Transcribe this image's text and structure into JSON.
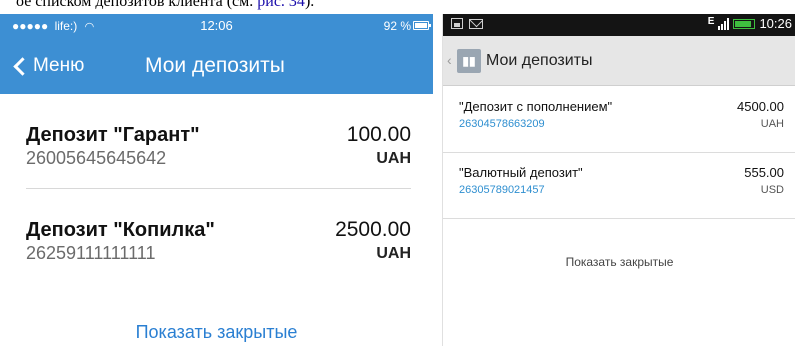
{
  "caption": {
    "text": "ое списком депозитов клиента (см.",
    "link": "рис. 34",
    "tail": ")."
  },
  "ios": {
    "status": {
      "dots": "●●●●●",
      "carrier": "life:)",
      "wifi": "wifi-icon",
      "time": "12:06",
      "battery": "92 %"
    },
    "nav": {
      "back_label": "Меню",
      "title": "Мои депозиты"
    },
    "deposits": [
      {
        "name": "Депозит \"Гарант\"",
        "account": "26005645645642",
        "amount": "100.00",
        "currency": "UAH"
      },
      {
        "name": "Депозит \"Копилка\"",
        "account": "26259111111111",
        "amount": "2500.00",
        "currency": "UAH"
      }
    ],
    "show_closed": "Показать закрытые"
  },
  "android": {
    "status": {
      "network": "E",
      "time": "10:26"
    },
    "actionbar": {
      "title": "Мои депозиты",
      "up": "‹"
    },
    "deposits": [
      {
        "name": "\"Депозит с пополнением\"",
        "account": "26304578663209",
        "amount": "4500.00",
        "currency": "UAH"
      },
      {
        "name": "\"Валютный депозит\"",
        "account": "26305789021457",
        "amount": "555.00",
        "currency": "USD"
      }
    ],
    "show_closed": "Показать закрытые"
  },
  "colors": {
    "ios_accent": "#3d8fd3",
    "link_blue": "#2a7fd2",
    "android_account": "#2f8fd0",
    "android_status": "#141414"
  }
}
